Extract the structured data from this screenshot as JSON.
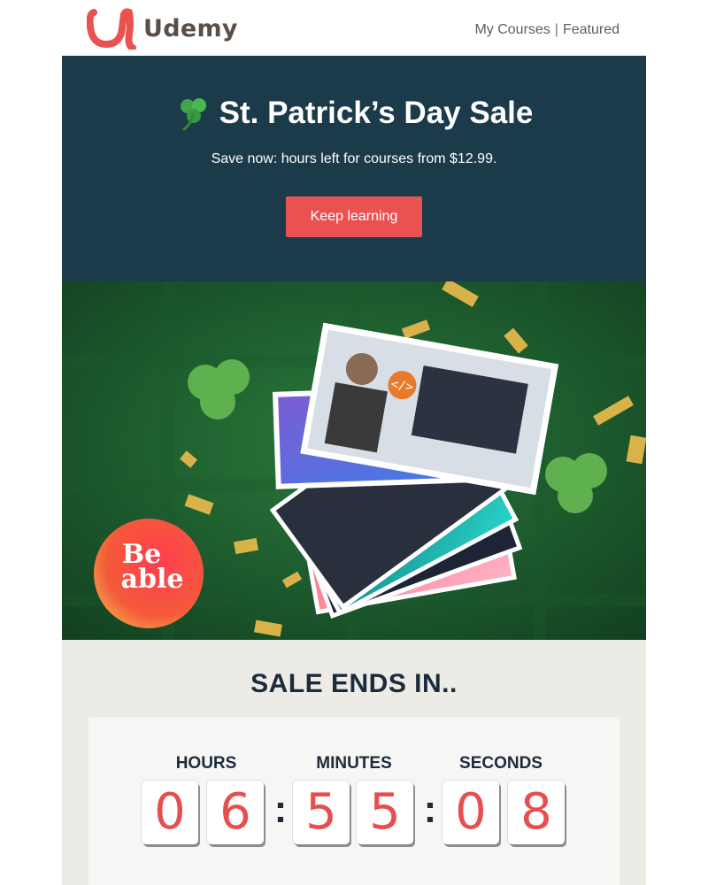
{
  "brand": {
    "name": "Udemy",
    "logo_color": "#ea5252"
  },
  "nav": {
    "my_courses": "My Courses",
    "separator": "|",
    "featured": "Featured"
  },
  "hero": {
    "icon": "shamrock-icon",
    "title": "St. Patrick’s Day Sale",
    "subtitle": "Save now: hours left for courses from $12.99.",
    "cta_label": "Keep learning",
    "bg_color": "#1b3b4b",
    "cta_color": "#ea5252"
  },
  "banner": {
    "badge_line1": "Be",
    "badge_line2": "able"
  },
  "countdown": {
    "title": "SALE ENDS IN..",
    "units": [
      {
        "label": "HOURS",
        "digits": [
          "0",
          "6"
        ]
      },
      {
        "label": "MINUTES",
        "digits": [
          "5",
          "5"
        ]
      },
      {
        "label": "SECONDS",
        "digits": [
          "0",
          "8"
        ]
      }
    ],
    "separator": ":",
    "digit_color": "#e64f4f"
  }
}
